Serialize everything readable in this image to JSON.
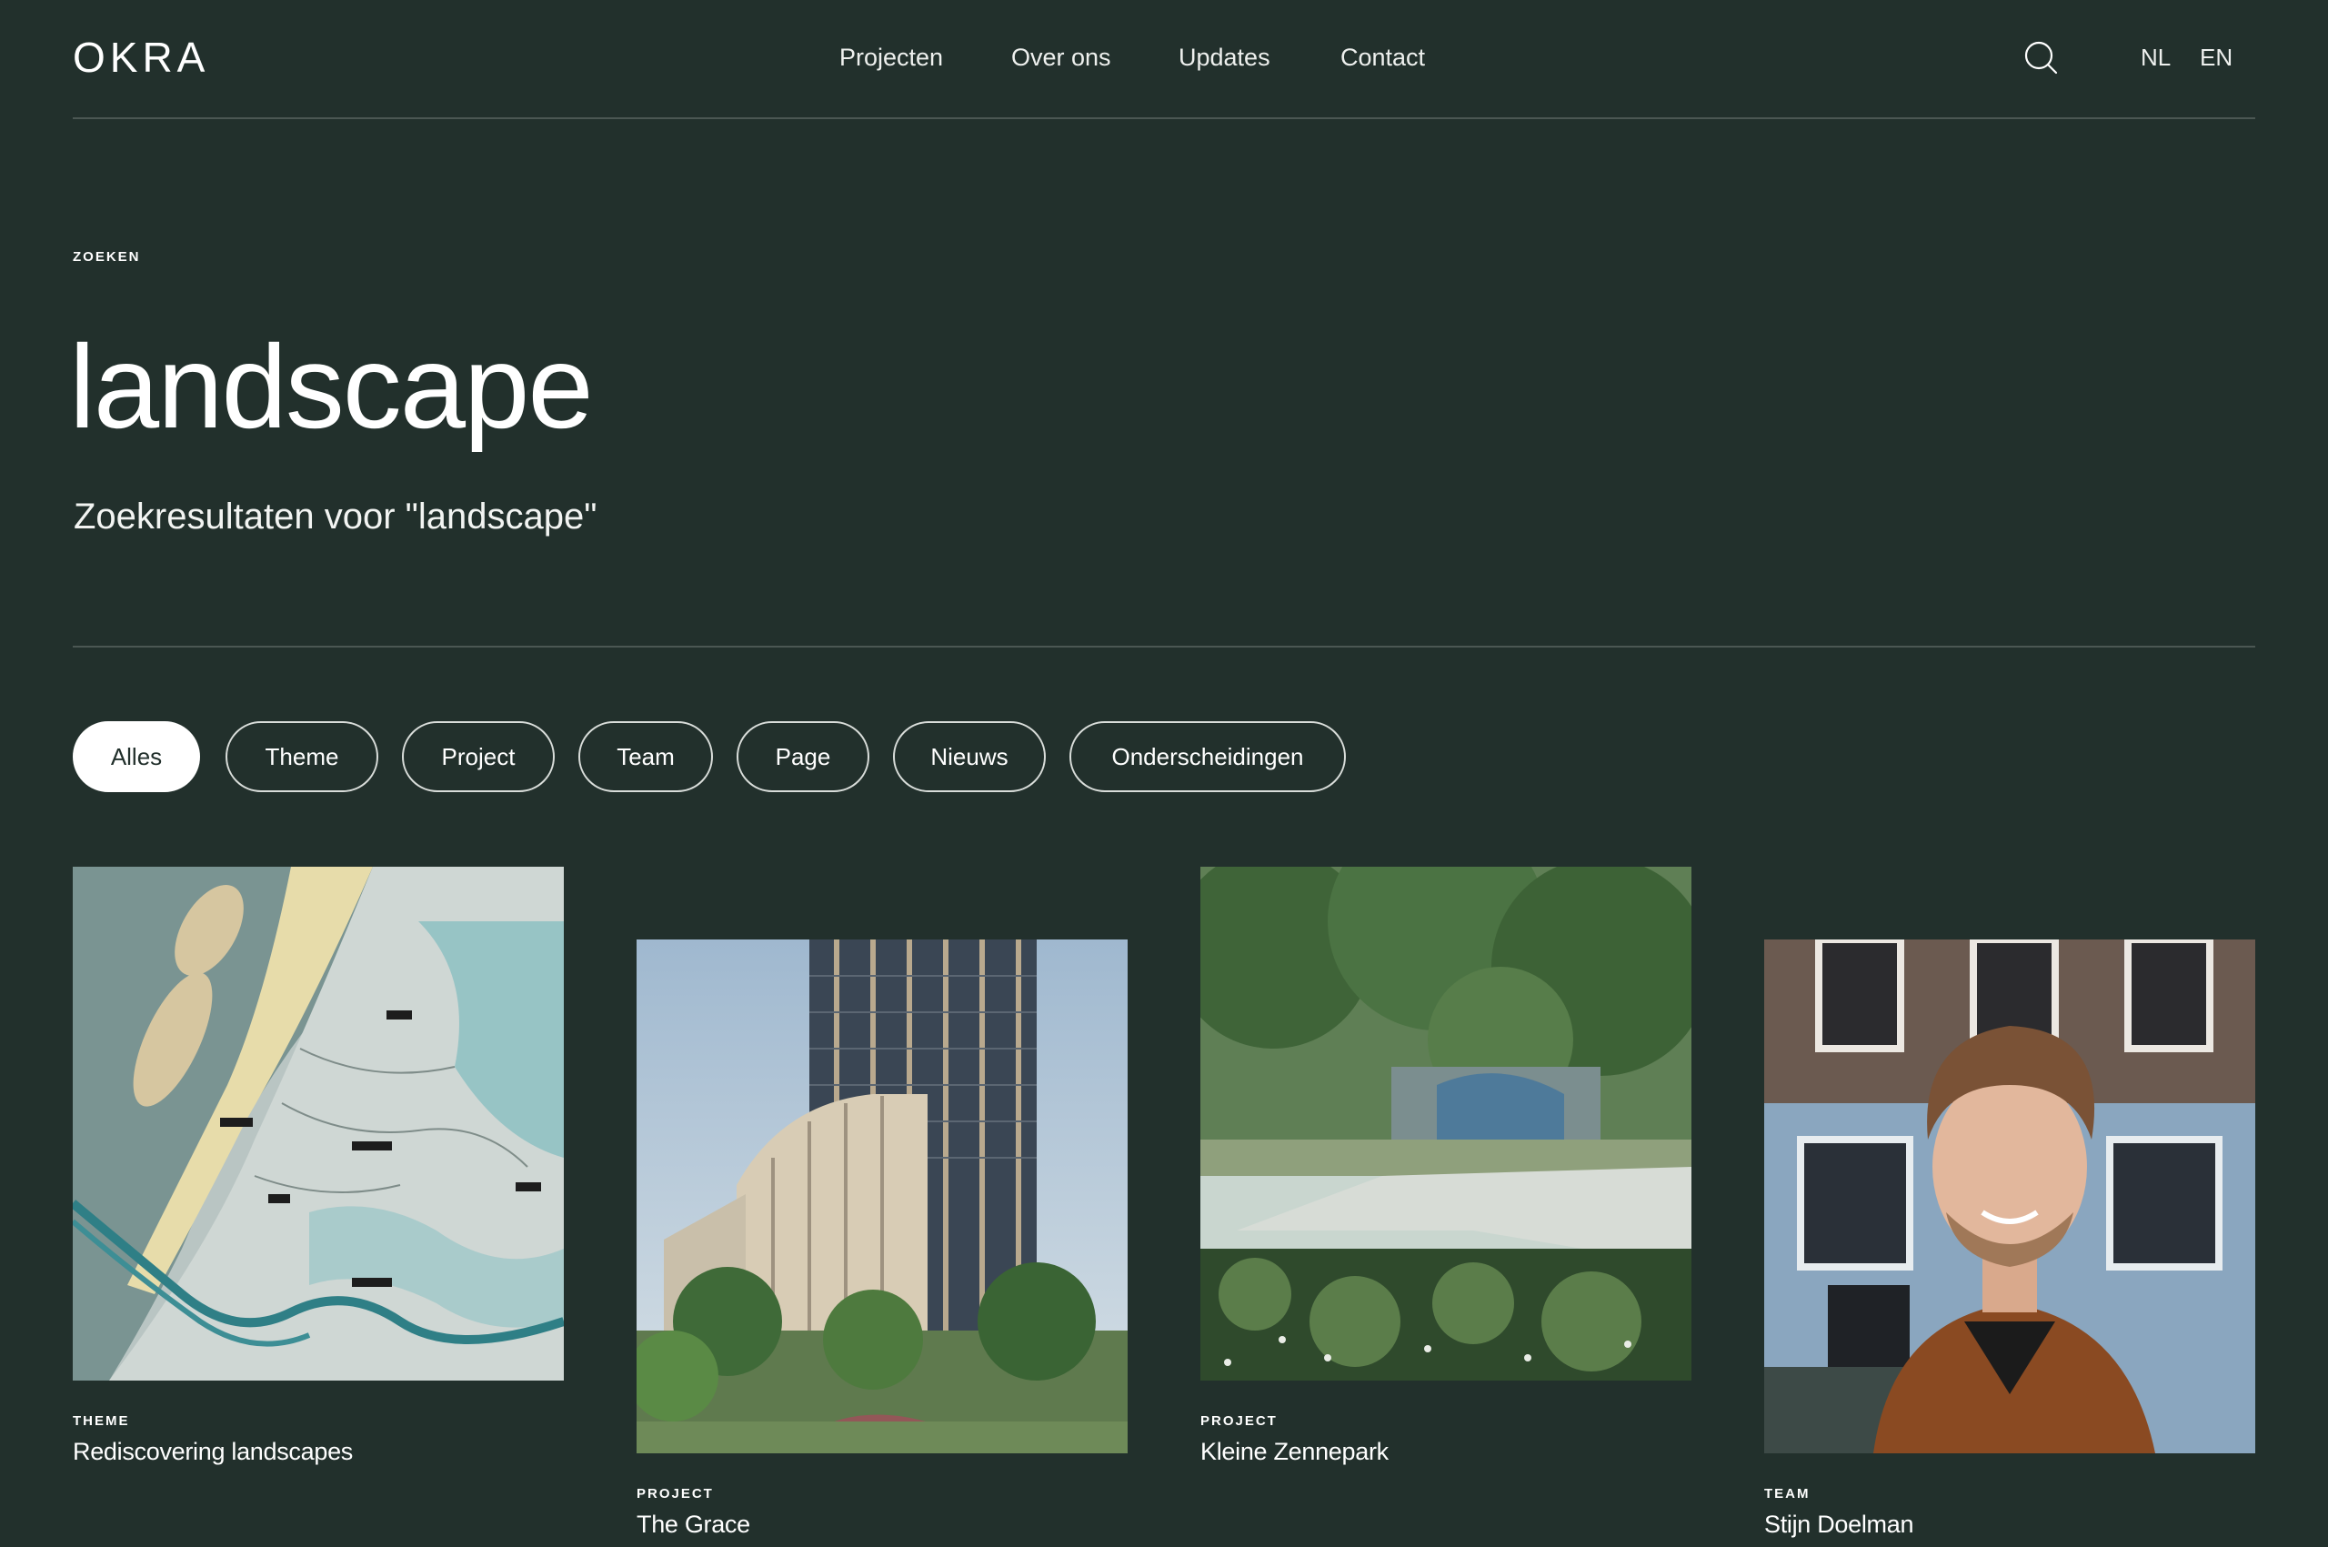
{
  "header": {
    "logo": "OKRA",
    "nav": [
      {
        "label": "Projecten"
      },
      {
        "label": "Over ons"
      },
      {
        "label": "Updates"
      },
      {
        "label": "Contact"
      }
    ],
    "search_icon": "search-icon",
    "languages": [
      "NL",
      "EN"
    ]
  },
  "page": {
    "kicker": "ZOEKEN",
    "title": "landscape",
    "subtitle": "Zoekresultaten voor \"landscape\""
  },
  "filters": [
    {
      "label": "Alles",
      "active": true
    },
    {
      "label": "Theme",
      "active": false
    },
    {
      "label": "Project",
      "active": false
    },
    {
      "label": "Team",
      "active": false
    },
    {
      "label": "Page",
      "active": false
    },
    {
      "label": "Nieuws",
      "active": false
    },
    {
      "label": "Onderscheidingen",
      "active": false
    }
  ],
  "results": [
    {
      "type": "THEME",
      "title": "Rediscovering landscapes",
      "image": "map-illustration"
    },
    {
      "type": "PROJECT",
      "title": "The Grace",
      "image": "tower-rendering"
    },
    {
      "type": "PROJECT",
      "title": "Kleine Zennepark",
      "image": "park-rendering"
    },
    {
      "type": "TEAM",
      "title": "Stijn Doelman",
      "image": "portrait-photo"
    }
  ],
  "colors": {
    "background": "#22302c",
    "divider": "#4b5753",
    "text": "#ffffff"
  }
}
